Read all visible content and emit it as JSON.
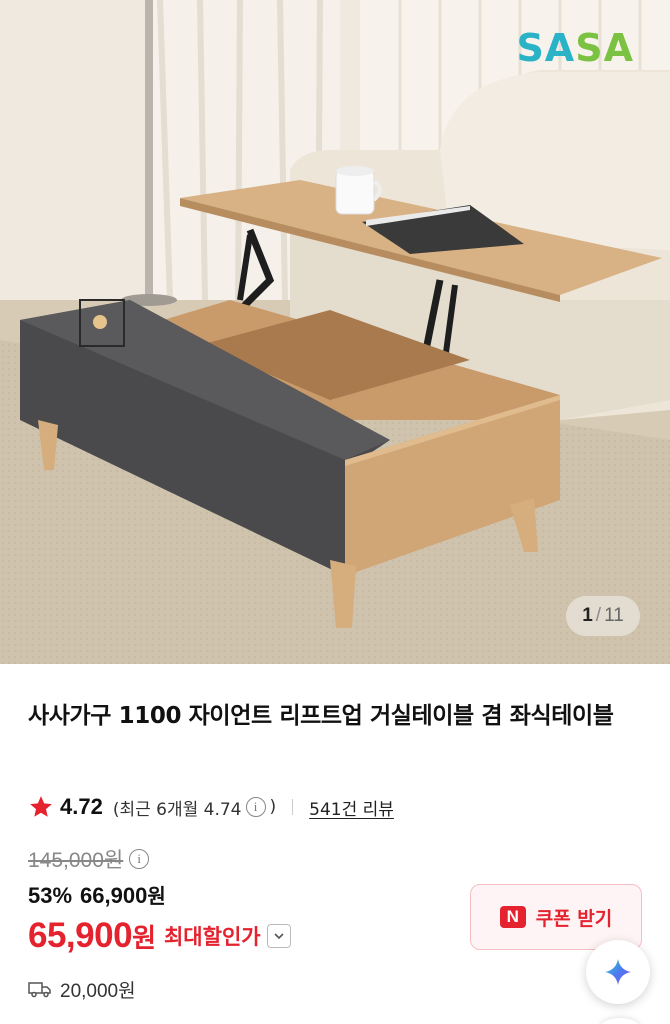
{
  "gallery": {
    "brand_logo": {
      "part1": "SA",
      "part2": "SA"
    },
    "counter": {
      "current": "1",
      "separator": "/",
      "total": "11"
    }
  },
  "product": {
    "title": "사사가구 1100 자이언트 리프트업 거실테이블 겸 좌식테이블",
    "rating": {
      "score": "4.72",
      "recent_prefix": "(최근 6개월 4.74",
      "recent_suffix": ")",
      "review_count": "541건 리뷰"
    },
    "price": {
      "original": "145,000원",
      "discount_rate": "53%",
      "sale_price": "66,900",
      "sale_price_unit": "원",
      "max_discount_price": "65,900",
      "max_discount_unit": "원",
      "max_discount_label": "최대할인가"
    },
    "coupon": {
      "badge": "N",
      "label": "쿠폰 받기"
    },
    "shipping": {
      "fee": "20,000원"
    }
  },
  "colors": {
    "accent_red": "#e4232f",
    "brand_blue": "#2ab3c6",
    "brand_green": "#7cc242"
  },
  "icons": [
    "star-icon",
    "info-icon",
    "chevron-down-icon",
    "truck-icon",
    "ai-assistant-icon"
  ]
}
